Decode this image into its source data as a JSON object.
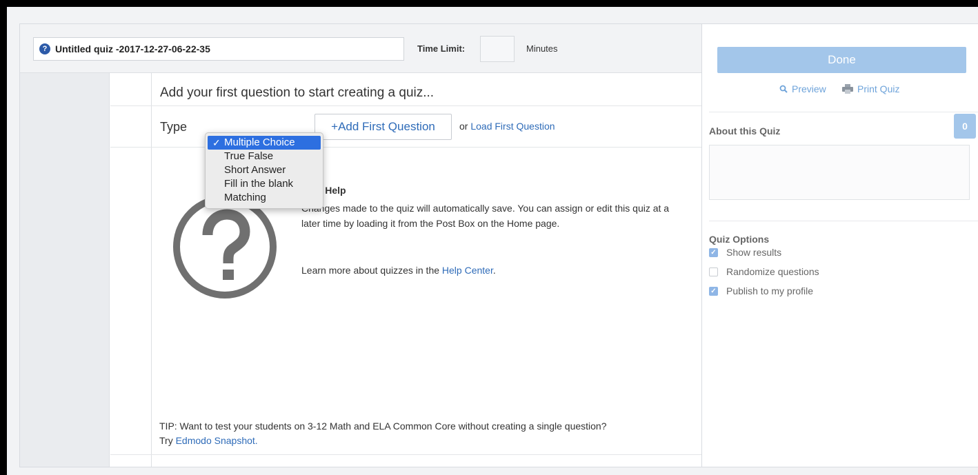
{
  "header": {
    "quiz_title": "Untitled quiz -2017-12-27-06-22-35",
    "time_limit_label": "Time Limit:",
    "time_limit_value": "",
    "minutes_label": "Minutes"
  },
  "main": {
    "heading": "Add your first question to start creating a quiz...",
    "type_label": "Type",
    "add_button": "+Add First Question",
    "or_text": "or",
    "load_link": "Load First Question",
    "type_options": [
      "Multiple Choice",
      "True False",
      "Short Answer",
      "Fill in the blank",
      "Matching"
    ],
    "selected_type": "Multiple Choice",
    "help": {
      "title": "Quiz Help",
      "text": "Changes made to the quiz will automatically save. You can assign or edit this quiz at a later time by loading it from the Post Box on the Home page.",
      "more_prefix": "Learn more about quizzes in the",
      "more_link": "Help Center",
      "more_suffix": "."
    },
    "tip": {
      "text": "TIP: Want to test your students on 3-12 Math and ELA Common Core without creating a single question?",
      "try_prefix": "Try",
      "link": "Edmodo Snapshot."
    }
  },
  "sidebar": {
    "done_button": "Done",
    "preview_link": "Preview",
    "print_link": "Print Quiz",
    "about_title": "About this Quiz",
    "question_count": "0",
    "options_title": "Quiz Options",
    "options": [
      {
        "label": "Show results",
        "checked": true
      },
      {
        "label": "Randomize questions",
        "checked": false
      },
      {
        "label": "Publish to my profile",
        "checked": true
      }
    ]
  },
  "colors": {
    "accent": "#2e6bb8",
    "done_button": "#a3c6ea",
    "dropdown_selected": "#2d6fe0"
  },
  "icons": [
    "quiz-icon",
    "question-mark-icon",
    "magnifier-icon",
    "printer-icon",
    "checkmark-icon"
  ]
}
